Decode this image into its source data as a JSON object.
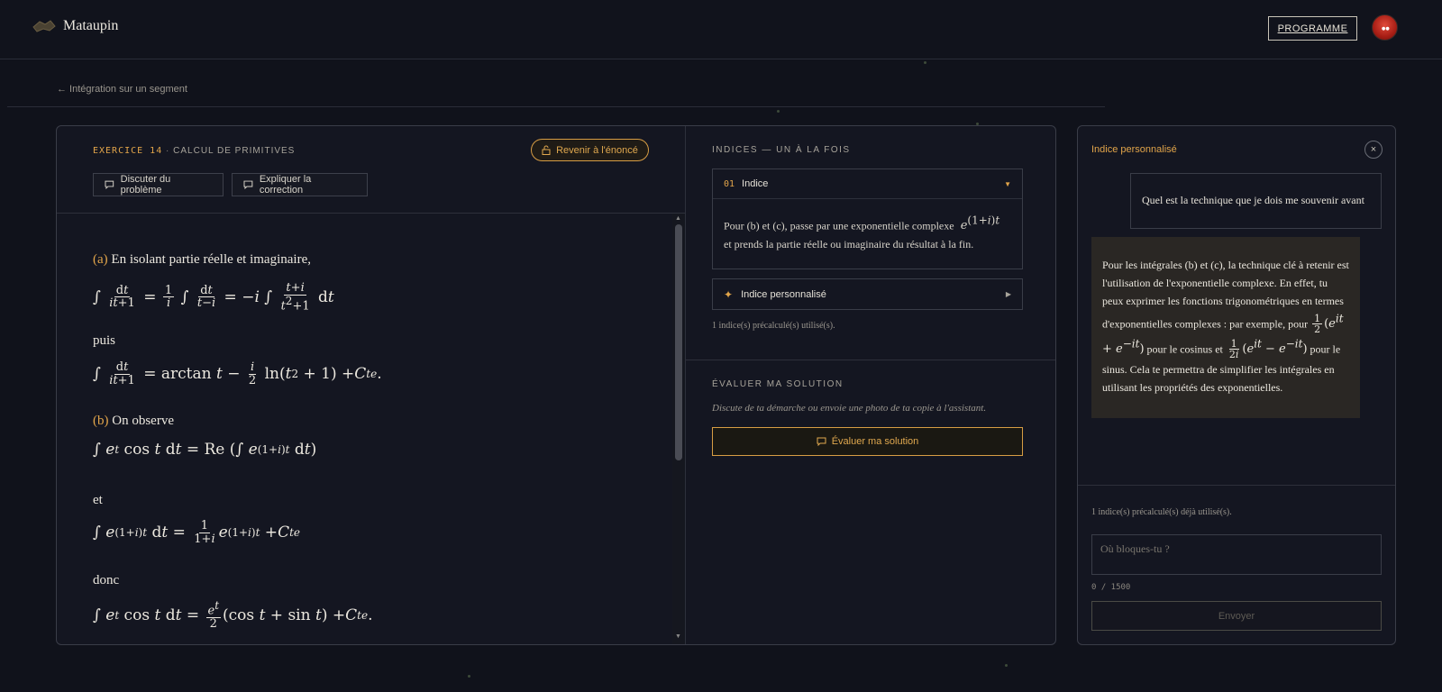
{
  "header": {
    "app_name": "Mataupin",
    "program_button": "PROGRAMME"
  },
  "breadcrumb": "← Intégration sur un segment",
  "exercise": {
    "number": "EXERCICE 14",
    "separator": "·",
    "title": "CALCUL DE PRIMITIVES",
    "return_button": "Revenir à l'énoncé",
    "discuss_button": "Discuter du problème",
    "explain_button": "Expliquer la correction"
  },
  "correction": {
    "a_label": "(a)",
    "a_text": "En isolant partie réelle et imaginaire,",
    "puis": "puis",
    "b_label": "(b)",
    "b_text": "On observe",
    "et": "et",
    "donc": "donc"
  },
  "hints": {
    "section_title": "INDICES — UN À LA FOIS",
    "hint1_number": "01",
    "hint1_label": "Indice",
    "hint1_text": "Pour (b) et (c), passe par une exponentielle complexe",
    "hint1_text2": "et prends la partie réelle ou imaginaire du résultat à la fin.",
    "personalized_label": "Indice personnalisé",
    "used_count": "1 indice(s) précalculé(s) utilisé(s)."
  },
  "evaluate": {
    "section_title": "ÉVALUER MA SOLUTION",
    "description": "Discute de ta démarche ou envoie une photo de ta copie à l'assistant.",
    "button": "Évaluer ma solution"
  },
  "assistant": {
    "title": "Indice personnalisé",
    "close": "×",
    "user_message": "Quel est la technique que je dois me souvenir avant",
    "ai_message_1": "Pour les intégrales (b) et (c), la technique clé à retenir est l'utilisation de l'exponentielle complexe. En effet, tu peux exprimer les fonctions trigonométriques en termes d'exponentielles complexes : par exemple, pour",
    "ai_message_cos": "pour le cosinus et",
    "ai_message_2": "pour le sinus. Cela te permettra de simplifier les intégrales en utilisant les propriétés des exponentielles.",
    "used_count": "1 indice(s) précalculé(s) déjà utilisé(s).",
    "input_placeholder": "Où bloques-tu ?",
    "char_count": "0 / 1500",
    "send_button": "Envoyer"
  },
  "colors": {
    "background": "#10121b",
    "accent": "#e2a54a",
    "panel": "#141621"
  }
}
